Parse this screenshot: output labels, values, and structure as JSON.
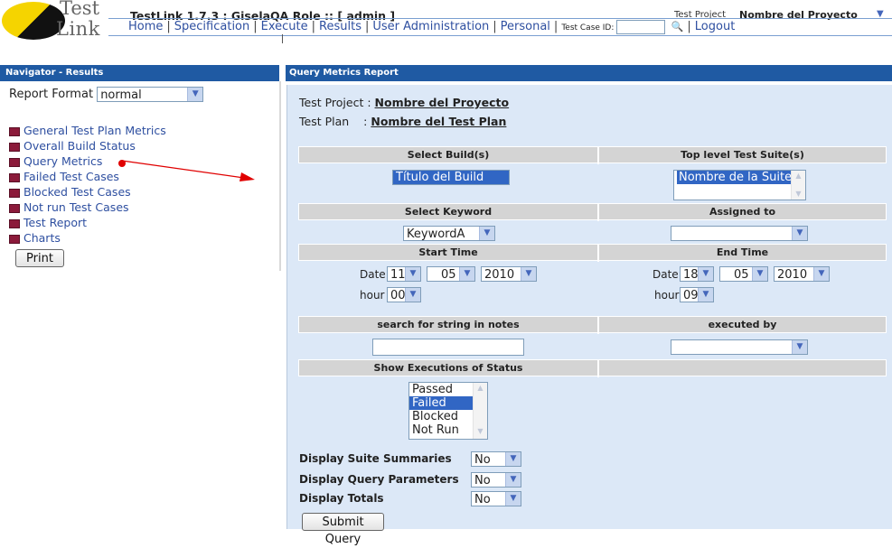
{
  "header": {
    "logo_word_1": "Test",
    "logo_word_2": "Link",
    "app_title": "TestLink 1.7.3 : GiselaQA Role :: [ admin ]",
    "test_project_label": "Test Project",
    "test_project_value": "Nombre del Proyecto"
  },
  "menu": {
    "home": "Home",
    "specification": "Specification",
    "execute": "Execute",
    "results": "Results",
    "user_admin": "User Administration",
    "personal": "Personal",
    "test_case_id_label": "Test Case ID:",
    "test_case_id_value": "",
    "logout": "Logout"
  },
  "navigator": {
    "title": "Navigator - Results",
    "report_format_label": "Report Format",
    "report_format_value": "normal",
    "items": [
      "General Test Plan Metrics",
      "Overall Build Status",
      "Query Metrics",
      "Failed Test Cases",
      "Blocked Test Cases",
      "Not run Test Cases",
      "Test Report",
      "Charts"
    ],
    "print_label": "Print"
  },
  "report": {
    "title": "Query Metrics Report",
    "test_project_label": "Test Project :",
    "test_project_value": "Nombre del Proyecto",
    "test_plan_label": "Test Plan",
    "test_plan_sep": ":",
    "test_plan_value": "Nombre del Test Plan",
    "select_builds_header": "Select Build(s)",
    "top_suites_header": "Top level Test Suite(s)",
    "build_option": "Título del Build",
    "suite_option": "Nombre de la Suite",
    "keyword_header": "Select Keyword",
    "assigned_header": "Assigned to",
    "keyword_value": "KeywordA",
    "assigned_value": "",
    "start_time_header": "Start Time",
    "end_time_header": "End Time",
    "date_label": "Date",
    "hour_label": "hour",
    "start_day": "11",
    "start_month": "05",
    "start_year": "2010",
    "start_hour": "00",
    "end_day": "18",
    "end_month": "05",
    "end_year": "2010",
    "end_hour": "09",
    "search_notes_header": "search for string in notes",
    "executed_by_header": "executed by",
    "search_notes_value": "",
    "executed_by_value": "",
    "status_header": "Show Executions of Status",
    "status_options": [
      "Passed",
      "Failed",
      "Blocked",
      "Not Run"
    ],
    "status_selected": "Failed",
    "display_suite_summaries_label": "Display Suite Summaries",
    "display_suite_summaries_value": "No",
    "display_query_params_label": "Display Query Parameters",
    "display_query_params_value": "No",
    "display_totals_label": "Display Totals",
    "display_totals_value": "No",
    "submit_label": "Submit Query"
  },
  "colors": {
    "title_bar": "#1f5aa3",
    "panel_bg": "#dce8f7",
    "link": "#2e4fa0",
    "selection": "#3166c4",
    "annotation_red": "#e00000"
  }
}
